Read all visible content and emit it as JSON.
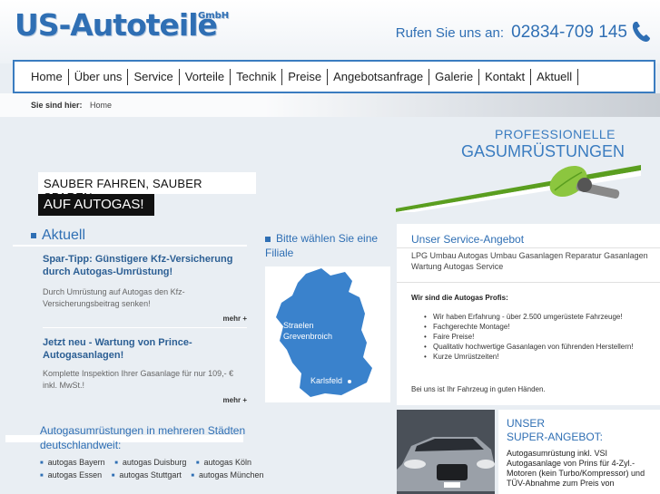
{
  "header": {
    "logo": "US-Autoteile",
    "logo_suffix": "GmbH",
    "phone_label": "Rufen Sie uns an:",
    "phone_number": "02834-709 145"
  },
  "nav": [
    "Home",
    "Über uns",
    "Service",
    "Vorteile",
    "Technik",
    "Preise",
    "Angebotsanfrage",
    "Galerie",
    "Kontakt",
    "Aktuell"
  ],
  "breadcrumb": {
    "label": "Sie sind hier:",
    "current": "Home"
  },
  "promo": {
    "line1": "PROFESSIONELLE",
    "line2": "GASUMRÜSTUNGEN"
  },
  "tagline": {
    "line1": "SAUBER FAHREN, SAUBER SPAREN …",
    "line2": "AUF AUTOGAS!"
  },
  "aktuell": {
    "title": "Aktuell",
    "items": [
      {
        "title": "Spar-Tipp: Günstigere Kfz-Versicherung durch Autogas-Umrüstung!",
        "text": "Durch Umrüstung auf Autogas den Kfz-Versicherungsbeitrag senken!",
        "more": "mehr +"
      },
      {
        "title": "Jetzt neu - Wartung von Prince-Autogasanlagen!",
        "text": "Komplette Inspektion Ihrer Gasanlage für nur 109,- € inkl. MwSt.!",
        "more": "mehr +"
      }
    ]
  },
  "cities": {
    "title": "Autogasumrüstungen in mehreren Städten deutschlandweit:",
    "items": [
      "autogas Bayern",
      "autogas Duisburg",
      "autogas Köln",
      "autogas Essen",
      "autogas Stuttgart",
      "autogas München"
    ]
  },
  "filiale": {
    "title": "Bitte wählen Sie eine Filiale",
    "locations": [
      "Straelen",
      "Grevenbroich",
      "Karlsfeld"
    ]
  },
  "service": {
    "title": "Unser Service-Angebot",
    "tags": "LPG Umbau  Autogas Umbau  Gasanlagen Reparatur  Gasanlagen Wartung  Autogas Service",
    "profis": "Wir sind die Autogas Profis:",
    "list": [
      "Wir haben Erfahrung - über 2.500 umgerüstete Fahrzeuge!",
      "Fachgerechte Montage!",
      "Faire Preise!",
      "Qualitativ hochwertige Gasanlagen von führenden Herstellern!",
      "Kurze Umrüstzeiten!"
    ],
    "footer": "Bei uns ist Ihr Fahrzeug in guten Händen."
  },
  "super": {
    "title_line1": "UNSER",
    "title_line2": "SUPER-ANGEBOT:",
    "text": "Autogasumrüstung inkl. VSI Autogasanlage von Prins für 4-Zyl.-Motoren (kein Turbo/Kompressor) und TÜV-Abnahme zum Preis von"
  },
  "colors": {
    "accent": "#2f6fb4",
    "background": "#e9eef3",
    "green": "#5a9e1f"
  }
}
